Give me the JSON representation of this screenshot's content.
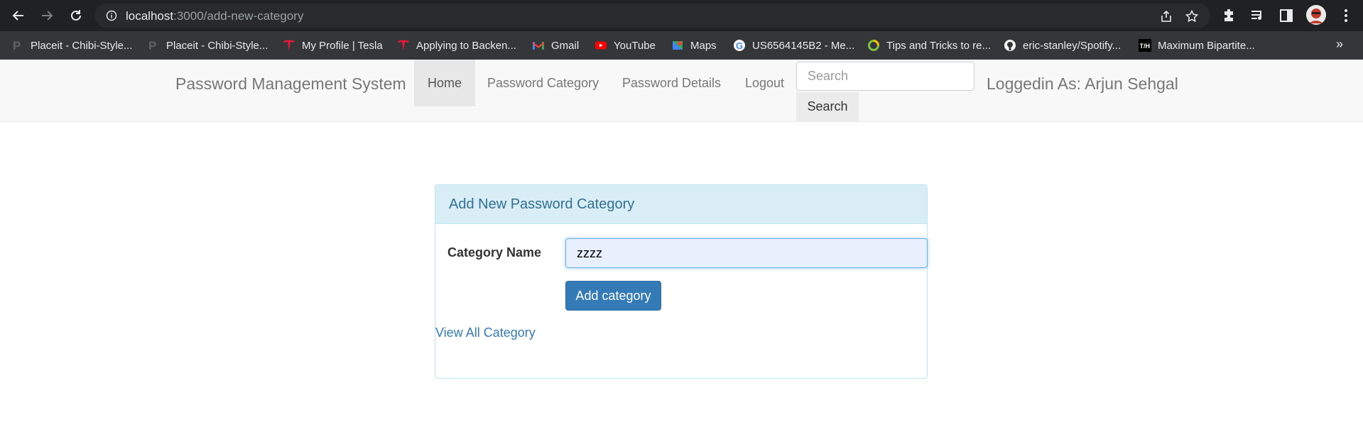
{
  "browser": {
    "url_host": "localhost",
    "url_path": ":3000/add-new-category",
    "bookmarks": [
      {
        "label": "Placeit - Chibi-Style...",
        "icon": "placeit-icon"
      },
      {
        "label": "Placeit - Chibi-Style...",
        "icon": "placeit-icon"
      },
      {
        "label": "My Profile | Tesla",
        "icon": "tesla-icon"
      },
      {
        "label": "Applying to Backen...",
        "icon": "tesla-icon"
      },
      {
        "label": "Gmail",
        "icon": "gmail-icon"
      },
      {
        "label": "YouTube",
        "icon": "youtube-icon"
      },
      {
        "label": "Maps",
        "icon": "maps-icon"
      },
      {
        "label": "US6564145B2 - Me...",
        "icon": "google-icon"
      },
      {
        "label": "Tips and Tricks to re...",
        "icon": "ring-icon"
      },
      {
        "label": "eric-stanley/Spotify...",
        "icon": "github-icon"
      },
      {
        "label": "Maximum Bipartite...",
        "icon": "th-icon"
      }
    ],
    "more_label": "»"
  },
  "navbar": {
    "brand": "Password Management System",
    "items": [
      {
        "label": "Home",
        "active": true
      },
      {
        "label": "Password Category",
        "active": false
      },
      {
        "label": "Password Details",
        "active": false
      },
      {
        "label": "Logout",
        "active": false
      }
    ],
    "search_placeholder": "Search",
    "search_button": "Search",
    "logged_in": "Loggedin As: Arjun Sehgal"
  },
  "panel": {
    "heading": "Add New Password Category",
    "field_label": "Category Name",
    "field_value": "zzzz",
    "submit_label": "Add category",
    "view_all_label": "View All Category"
  },
  "colors": {
    "primary": "#337ab7",
    "panel_heading_bg": "#d9edf7",
    "panel_heading_text": "#31708f",
    "navbar_bg": "#f8f8f8"
  }
}
